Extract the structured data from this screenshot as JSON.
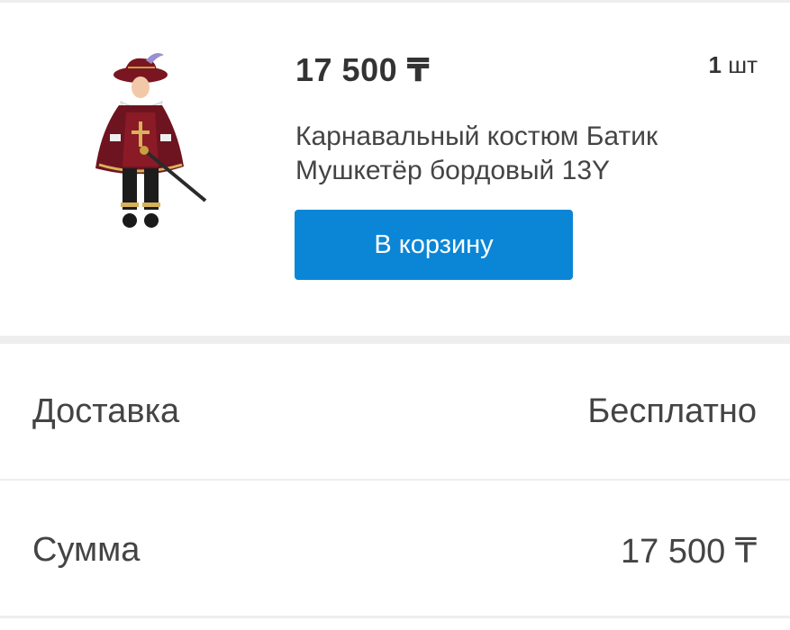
{
  "product": {
    "price": "17 500 ₸",
    "quantity_value": "1",
    "quantity_unit": "шт",
    "title": "Карнавальный костюм Батик Мушкетёр бордовый 13Y",
    "image_alt": "Карнавальный костюм Мушкетёр",
    "cart_button_label": "В корзину"
  },
  "summary": {
    "delivery_label": "Доставка",
    "delivery_value": "Бесплатно",
    "sum_label": "Сумма",
    "sum_value": "17 500 ₸"
  },
  "colors": {
    "button": "#0b86d6",
    "separator": "#eeeeee",
    "costume_burgundy": "#7a1621"
  }
}
